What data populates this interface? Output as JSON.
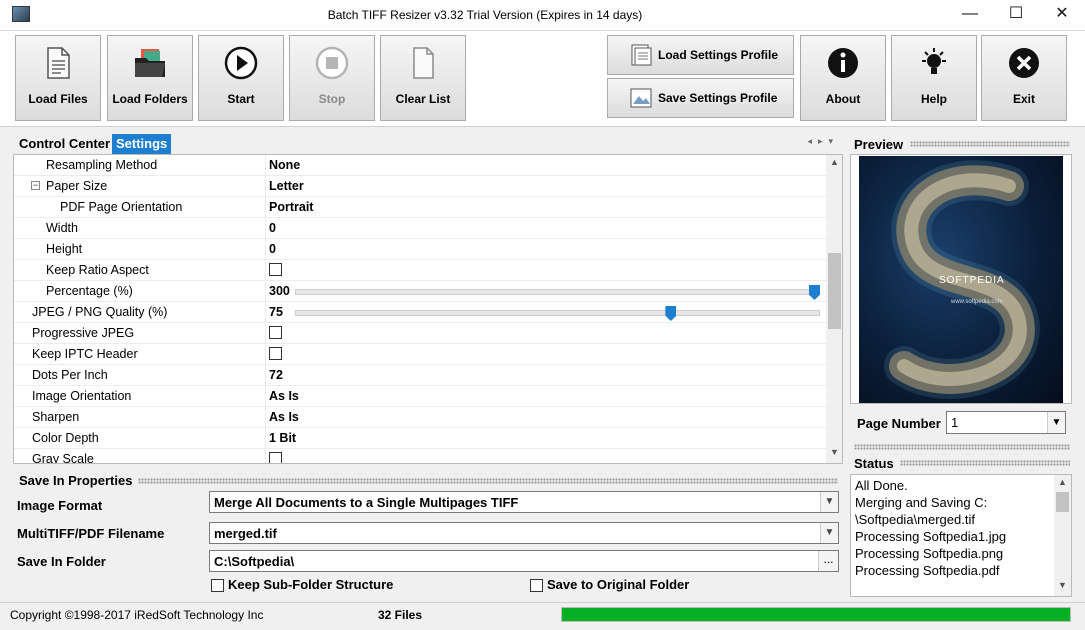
{
  "window": {
    "title": "Batch TIFF Resizer v3.32   Trial Version (Expires in 14 days)",
    "minimize": "—",
    "maximize": "☐",
    "close": "✕"
  },
  "toolbar": {
    "load_files": "Load Files",
    "load_folders": "Load Folders",
    "start": "Start",
    "stop": "Stop",
    "clear_list": "Clear List",
    "load_profile": "Load Settings Profile",
    "save_profile": "Save Settings Profile",
    "about": "About",
    "help": "Help",
    "exit": "Exit"
  },
  "tabs": {
    "control_center": "Control Center",
    "settings": "Settings",
    "arrows": "◂▸▾"
  },
  "settings": [
    {
      "name": "Resampling Method",
      "value": "None",
      "indent": 1
    },
    {
      "name": "Paper Size",
      "value": "Letter",
      "indent": 1,
      "expander": "−"
    },
    {
      "name": "PDF Page Orientation",
      "value": "Portrait",
      "indent": 2
    },
    {
      "name": "Width",
      "value": "0",
      "indent": 1
    },
    {
      "name": "Height",
      "value": "0",
      "indent": 1
    },
    {
      "name": "Keep Ratio Aspect",
      "checkbox": false,
      "indent": 1
    },
    {
      "name": "Percentage (%)",
      "value": "300",
      "indent": 1,
      "slider": 1.0
    },
    {
      "name": "JPEG / PNG Quality (%)",
      "value": "75",
      "indent": 0,
      "slider": 0.72
    },
    {
      "name": "Progressive JPEG",
      "checkbox": false,
      "indent": 0
    },
    {
      "name": "Keep IPTC Header",
      "checkbox": false,
      "indent": 0
    },
    {
      "name": "Dots Per Inch",
      "value": "72",
      "indent": 0
    },
    {
      "name": "Image Orientation",
      "value": "As Is",
      "indent": 0
    },
    {
      "name": "Sharpen",
      "value": "As Is",
      "indent": 0
    },
    {
      "name": "Color Depth",
      "value": "1 Bit",
      "indent": 0
    },
    {
      "name": "Gray Scale",
      "checkbox": false,
      "indent": 0
    }
  ],
  "save_props": {
    "title": "Save In Properties",
    "image_format_label": "Image Format",
    "image_format": "Merge All Documents to a Single Multipages TIFF",
    "filename_label": "MultiTIFF/PDF Filename",
    "filename": "merged.tif",
    "folder_label": "Save In Folder",
    "folder": "C:\\Softpedia\\",
    "browse": "...",
    "keep_subfolder": "Keep Sub-Folder Structure",
    "save_original": "Save to Original Folder"
  },
  "preview": {
    "title": "Preview",
    "page_label": "Page Number",
    "page": "1",
    "image_text": "SOFTPEDIA",
    "image_sub": "www.softpedia.com"
  },
  "status": {
    "title": "Status",
    "lines": [
      "All Done.",
      "Merging and Saving C:",
      "\\Softpedia\\merged.tif",
      "Processing Softpedia1.jpg",
      "Processing Softpedia.png",
      "Processing Softpedia.pdf"
    ]
  },
  "statusbar": {
    "copyright": "Copyright ©1998-2017 iRedSoft Technology Inc",
    "files": "32 Files",
    "progress": 1.0
  },
  "colors": {
    "accent": "#1e7fd0",
    "progress": "#06b025"
  }
}
